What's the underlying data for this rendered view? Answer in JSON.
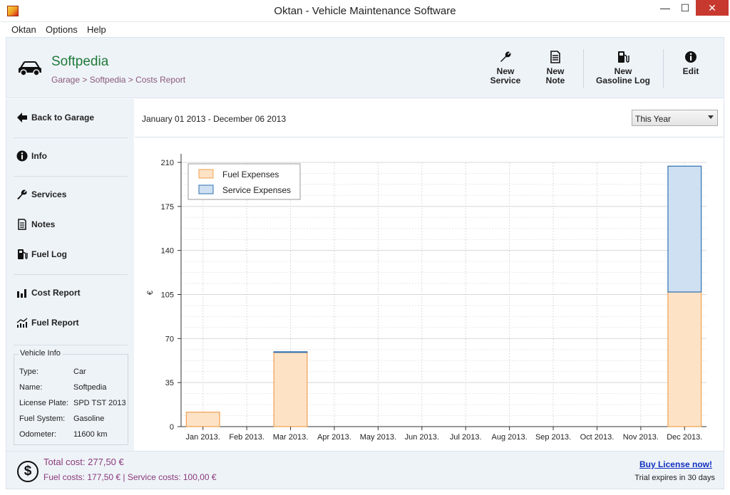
{
  "window": {
    "title": "Oktan - Vehicle Maintenance Software",
    "min_glyph": "—",
    "max_glyph": "☐",
    "close_glyph": "✕"
  },
  "menu": [
    "Oktan",
    "Options",
    "Help"
  ],
  "header": {
    "vehicle_name": "Softpedia",
    "breadcrumb": "Garage > Softpedia > Costs Report",
    "toolbar": {
      "new_service": [
        "New",
        "Service"
      ],
      "new_note": [
        "New",
        "Note"
      ],
      "new_gasoline_log": [
        "New",
        "Gasoline Log"
      ],
      "edit": "Edit"
    }
  },
  "sidebar": {
    "back": "Back to Garage",
    "info": "Info",
    "services": "Services",
    "notes": "Notes",
    "fuel_log": "Fuel Log",
    "cost_report": "Cost Report",
    "fuel_report": "Fuel Report",
    "vehicle_info": {
      "title": "Vehicle Info",
      "rows": [
        {
          "key": "Type:",
          "value": "Car"
        },
        {
          "key": "Name:",
          "value": "Softpedia"
        },
        {
          "key": "License Plate:",
          "value": "SPD TST 2013"
        },
        {
          "key": "Fuel System:",
          "value": "Gasoline"
        },
        {
          "key": "Odometer:",
          "value": "11600 km"
        }
      ]
    }
  },
  "main": {
    "date_range": "January 01 2013 - December 06 2013",
    "period_select": "This Year"
  },
  "chart_data": {
    "type": "bar",
    "stacked": true,
    "categories": [
      "Jan 2013.",
      "Feb 2013.",
      "Mar 2013.",
      "Apr 2013.",
      "May 2013.",
      "Jun 2013.",
      "Jul 2013.",
      "Aug 2013.",
      "Sep 2013.",
      "Oct 2013.",
      "Nov 2013.",
      "Dec 2013."
    ],
    "series": [
      {
        "name": "Fuel Expenses",
        "values": [
          11.5,
          0,
          59,
          0,
          0,
          0,
          0,
          0,
          0,
          0,
          0,
          107
        ],
        "color": "#fde2c6",
        "stroke": "#f0a050"
      },
      {
        "name": "Service Expenses",
        "values": [
          0,
          0,
          0.5,
          0,
          0,
          0,
          0,
          0,
          0,
          0,
          0,
          100
        ],
        "color": "#cfe0f2",
        "stroke": "#2e6fb0"
      }
    ],
    "ylabel": "€",
    "yticks": [
      0,
      35,
      70,
      105,
      140,
      175,
      210
    ],
    "ylim": [
      0,
      210
    ],
    "grid": true,
    "legend": "top-left"
  },
  "footer": {
    "total": "Total cost: 277,50 €",
    "breakdown": "Fuel costs: 177,50 € | Service costs: 100,00 €",
    "buy": "Buy License now!",
    "trial": "Trial expires in 30 days"
  }
}
